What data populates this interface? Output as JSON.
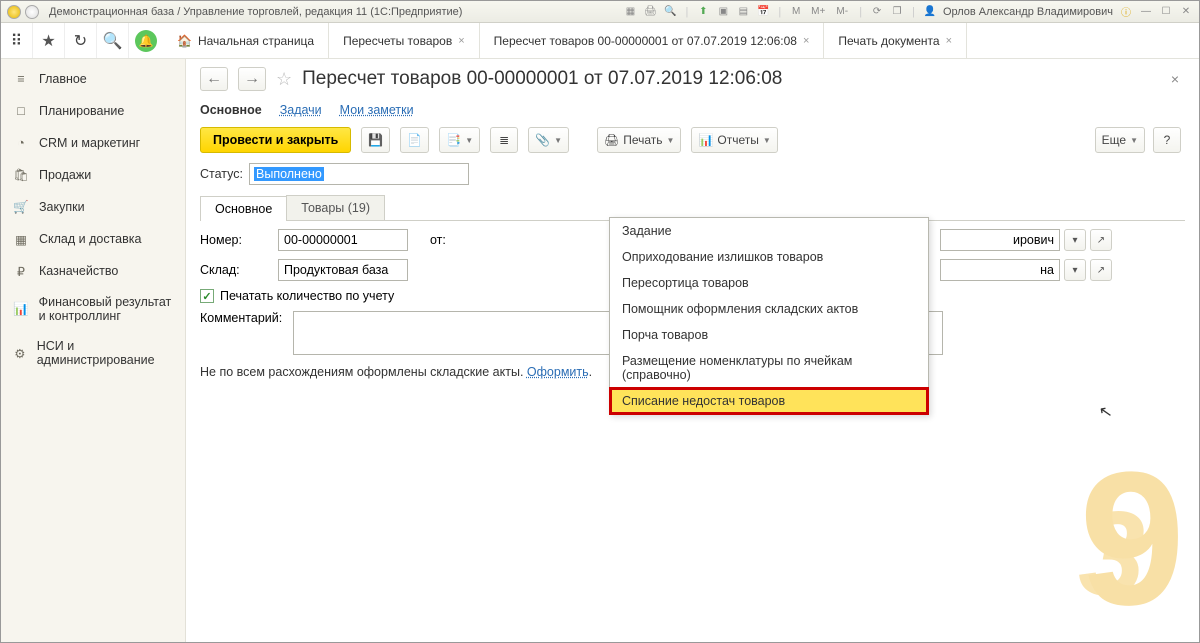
{
  "window": {
    "title": "Демонстрационная база / Управление торговлей, редакция 11  (1С:Предприятие)",
    "user": "Орлов Александр Владимирович",
    "m_labels": [
      "M",
      "M+",
      "M-"
    ]
  },
  "tabs": {
    "home": "Начальная страница",
    "t1": "Пересчеты товаров",
    "t2": "Пересчет товаров 00-00000001 от 07.07.2019 12:06:08",
    "t3": "Печать документа"
  },
  "sidebar": {
    "items": [
      {
        "label": "Главное",
        "icon": "≡"
      },
      {
        "label": "Планирование",
        "icon": "□"
      },
      {
        "label": "CRM и маркетинг",
        "icon": "◔"
      },
      {
        "label": "Продажи",
        "icon": "🛍"
      },
      {
        "label": "Закупки",
        "icon": "🛒"
      },
      {
        "label": "Склад и доставка",
        "icon": "▦"
      },
      {
        "label": "Казначейство",
        "icon": "₽"
      },
      {
        "label": "Финансовый результат и контроллинг",
        "icon": "📊"
      },
      {
        "label": "НСИ и администрирование",
        "icon": "⚙"
      }
    ]
  },
  "doc": {
    "title": "Пересчет товаров 00-00000001 от 07.07.2019 12:06:08",
    "links": {
      "main": "Основное",
      "tasks": "Задачи",
      "notes": "Мои заметки"
    },
    "actions": {
      "commit": "Провести и закрыть",
      "print": "Печать",
      "reports": "Отчеты",
      "more": "Еще",
      "help": "?"
    },
    "status_label": "Статус:",
    "status_value": "Выполнено",
    "doc_tabs": {
      "main": "Основное",
      "goods": "Товары (19)"
    },
    "form": {
      "number_label": "Номер:",
      "number_value": "00-00000001",
      "from_label": "от:",
      "resp_tail": "ирович",
      "warehouse_label": "Склад:",
      "warehouse_value": "Продуктовая база",
      "warehouse_tail": "на",
      "print_qty": "Печатать количество по учету",
      "comment_label": "Комментарий:",
      "footer_text": "Не по всем расхождениям оформлены складские акты. ",
      "footer_link": "Оформить"
    }
  },
  "dropdown": {
    "items": [
      "Задание",
      "Оприходование излишков товаров",
      "Пересортица товаров",
      "Помощник оформления складских актов",
      "Порча товаров",
      "Размещение номенклатуры по ячейкам (справочно)",
      "Списание недостач товаров"
    ]
  }
}
